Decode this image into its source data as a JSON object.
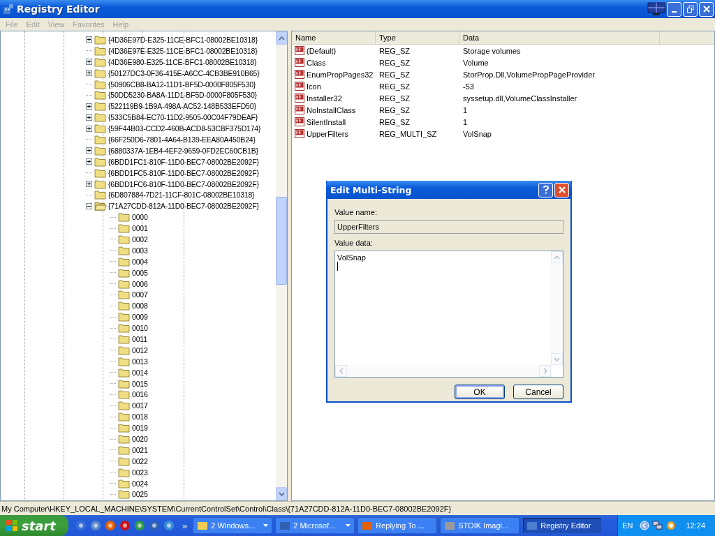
{
  "window": {
    "title": "Registry Editor"
  },
  "menu": [
    "File",
    "Edit",
    "View",
    "Favorites",
    "Help"
  ],
  "tree": [
    {
      "label": "{4D36E97D-E325-11CE-BFC1-08002BE10318}",
      "has_children": true,
      "expanded": false
    },
    {
      "label": "{4D36E97E-E325-11CE-BFC1-08002BE10318}",
      "has_children": false,
      "expanded": false
    },
    {
      "label": "{4D36E980-E325-11CE-BFC1-08002BE10318}",
      "has_children": true,
      "expanded": false
    },
    {
      "label": "{50127DC3-0F36-415E-A6CC-4CB3BE910B65}",
      "has_children": true,
      "expanded": false
    },
    {
      "label": "{50906CB8-BA12-11D1-BF5D-0000F805F530}",
      "has_children": false,
      "expanded": false
    },
    {
      "label": "{50DD5230-BA8A-11D1-BF5D-0000F805F530}",
      "has_children": false,
      "expanded": false
    },
    {
      "label": "{522119B9-1B9A-498A-AC52-148B533EFD50}",
      "has_children": true,
      "expanded": false
    },
    {
      "label": "{533C5B84-EC70-11D2-9505-00C04F79DEAF}",
      "has_children": true,
      "expanded": false
    },
    {
      "label": "{59F44B03-CCD2-460B-ACD8-53CBF375D174}",
      "has_children": true,
      "expanded": false
    },
    {
      "label": "{66F250D6-7801-4A64-B139-EEA80A450B24}",
      "has_children": false,
      "expanded": false
    },
    {
      "label": "{6880337A-1EB4-4EF2-9659-0FD2EC60CB1B}",
      "has_children": true,
      "expanded": false
    },
    {
      "label": "{6BDD1FC1-810F-11D0-BEC7-08002BE2092F}",
      "has_children": true,
      "expanded": false
    },
    {
      "label": "{6BDD1FC5-810F-11D0-BEC7-08002BE2092F}",
      "has_children": false,
      "expanded": false
    },
    {
      "label": "{6BDD1FC6-810F-11D0-BEC7-08002BE2092F}",
      "has_children": true,
      "expanded": false
    },
    {
      "label": "{6D807884-7D21-11CF-801C-08002BE10318}",
      "has_children": false,
      "expanded": false
    },
    {
      "label": "{71A27CDD-812A-11D0-BEC7-08002BE2092F}",
      "has_children": true,
      "expanded": true,
      "children": [
        {
          "label": "0000"
        },
        {
          "label": "0001"
        },
        {
          "label": "0002"
        },
        {
          "label": "0003"
        },
        {
          "label": "0004"
        },
        {
          "label": "0005"
        },
        {
          "label": "0006"
        },
        {
          "label": "0007"
        },
        {
          "label": "0008"
        },
        {
          "label": "0009"
        },
        {
          "label": "0010"
        },
        {
          "label": "0011"
        },
        {
          "label": "0012"
        },
        {
          "label": "0013"
        },
        {
          "label": "0014"
        },
        {
          "label": "0015"
        },
        {
          "label": "0016"
        },
        {
          "label": "0017"
        },
        {
          "label": "0018"
        },
        {
          "label": "0019"
        },
        {
          "label": "0020"
        },
        {
          "label": "0021"
        },
        {
          "label": "0022"
        },
        {
          "label": "0023"
        },
        {
          "label": "0024"
        },
        {
          "label": "0025"
        }
      ]
    }
  ],
  "values": {
    "columns": [
      "Name",
      "Type",
      "Data"
    ],
    "rows": [
      {
        "name": "(Default)",
        "type": "REG_SZ",
        "data": "Storage volumes"
      },
      {
        "name": "Class",
        "type": "REG_SZ",
        "data": "Volume"
      },
      {
        "name": "EnumPropPages32",
        "type": "REG_SZ",
        "data": "StorProp.Dll,VolumePropPageProvider"
      },
      {
        "name": "Icon",
        "type": "REG_SZ",
        "data": "-53"
      },
      {
        "name": "Installer32",
        "type": "REG_SZ",
        "data": "syssetup.dll,VolumeClassInstaller"
      },
      {
        "name": "NoInstallClass",
        "type": "REG_SZ",
        "data": "1"
      },
      {
        "name": "SilentInstall",
        "type": "REG_SZ",
        "data": "1"
      },
      {
        "name": "UpperFilters",
        "type": "REG_MULTI_SZ",
        "data": "VolSnap"
      }
    ]
  },
  "dialog": {
    "title": "Edit Multi-String",
    "value_name_label": "Value name:",
    "value_name": "UpperFilters",
    "value_data_label": "Value data:",
    "value_data": "VolSnap",
    "buttons": [
      "OK",
      "Cancel"
    ]
  },
  "status_bar": "My Computer\\HKEY_LOCAL_MACHINE\\SYSTEM\\CurrentControlSet\\Control\\Class\\{71A27CDD-812A-11D0-BEC7-08002BE2092F}",
  "taskbar": {
    "start": "start",
    "overflow": "»",
    "tasks": [
      {
        "label": "2 Windows...",
        "grouped": true,
        "selected": false
      },
      {
        "label": "2 Microsof...",
        "grouped": true,
        "selected": false
      },
      {
        "label": "Replying To ...",
        "grouped": false,
        "selected": false
      },
      {
        "label": "STOIK Imagi...",
        "grouped": false,
        "selected": false
      },
      {
        "label": "Registry Editor",
        "grouped": false,
        "selected": true
      }
    ],
    "language": "EN",
    "clock": "12:24"
  }
}
